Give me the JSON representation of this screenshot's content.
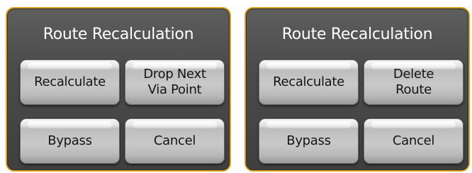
{
  "dialogs": [
    {
      "title": "Route Recalculation",
      "buttons": {
        "recalculate": "Recalculate",
        "secondary": "Drop Next\nVia Point",
        "bypass": "Bypass",
        "cancel": "Cancel"
      }
    },
    {
      "title": "Route Recalculation",
      "buttons": {
        "recalculate": "Recalculate",
        "secondary": "Delete\nRoute",
        "bypass": "Bypass",
        "cancel": "Cancel"
      }
    }
  ],
  "colors": {
    "frame_border": "#d9a21a",
    "panel_background": "#4c4c4c",
    "button_face": "#c9c9c9",
    "title_text": "#ffffff",
    "button_text": "#151515"
  }
}
